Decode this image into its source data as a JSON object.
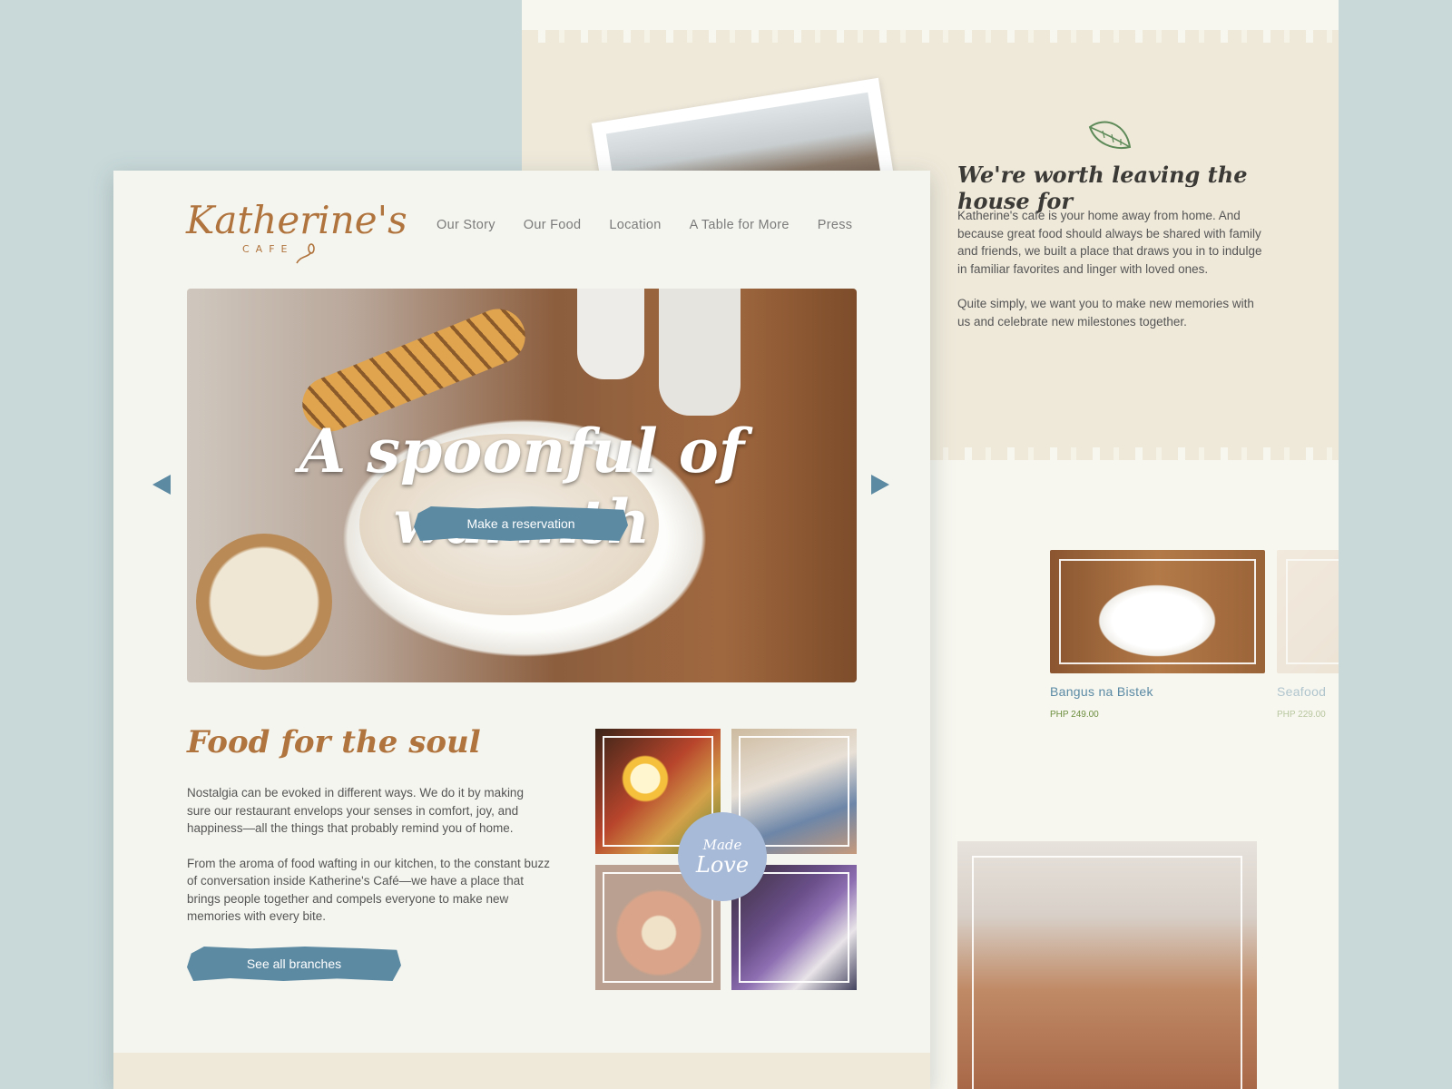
{
  "back": {
    "worth_title": "We're worth leaving the house for",
    "paragraphs": [
      "Katherine's cafe is your home away from home. And because great food should always be shared with family and friends, we built a place that draws you in to indulge in familiar favorites and linger with loved ones.",
      "Quite simply, we want you to make new memories with us and celebrate new milestones together."
    ],
    "foods": [
      {
        "name": "",
        "price": ""
      },
      {
        "name": "Bangus na Bistek",
        "price": "PHP 249.00"
      },
      {
        "name": "Seafood",
        "price": "PHP 229.00"
      }
    ]
  },
  "front": {
    "logo": {
      "script": "Katherine's",
      "sub": "CAFE"
    },
    "nav": [
      "Our Story",
      "Our Food",
      "Location",
      "A Table for More",
      "Press"
    ],
    "hero": {
      "title": "A spoonful of warmth",
      "cta": "Make a reservation"
    },
    "soul": {
      "title": "Food for the soul",
      "paragraphs": [
        "Nostalgia can be evoked in different ways. We do it by making sure our restaurant envelops your senses in comfort, joy, and happiness—all the things that probably remind you of home.",
        "From the aroma of food wafting in our kitchen, to the constant buzz of conversation inside Katherine's Café—we have a place that brings people together and compels everyone to make new memories with every bite."
      ],
      "cta": "See all branches"
    },
    "badge": {
      "line1": "Made",
      "line2": "Love"
    }
  },
  "colors": {
    "accent": "#5c8aa3",
    "brand": "#b0743e",
    "background": "#c9d9da",
    "price": "#6d8f3f"
  },
  "icons": {
    "leaf": "leaf-icon",
    "prev": "prev-arrow-icon",
    "next": "next-arrow-icon",
    "spoon": "spoon-icon"
  }
}
